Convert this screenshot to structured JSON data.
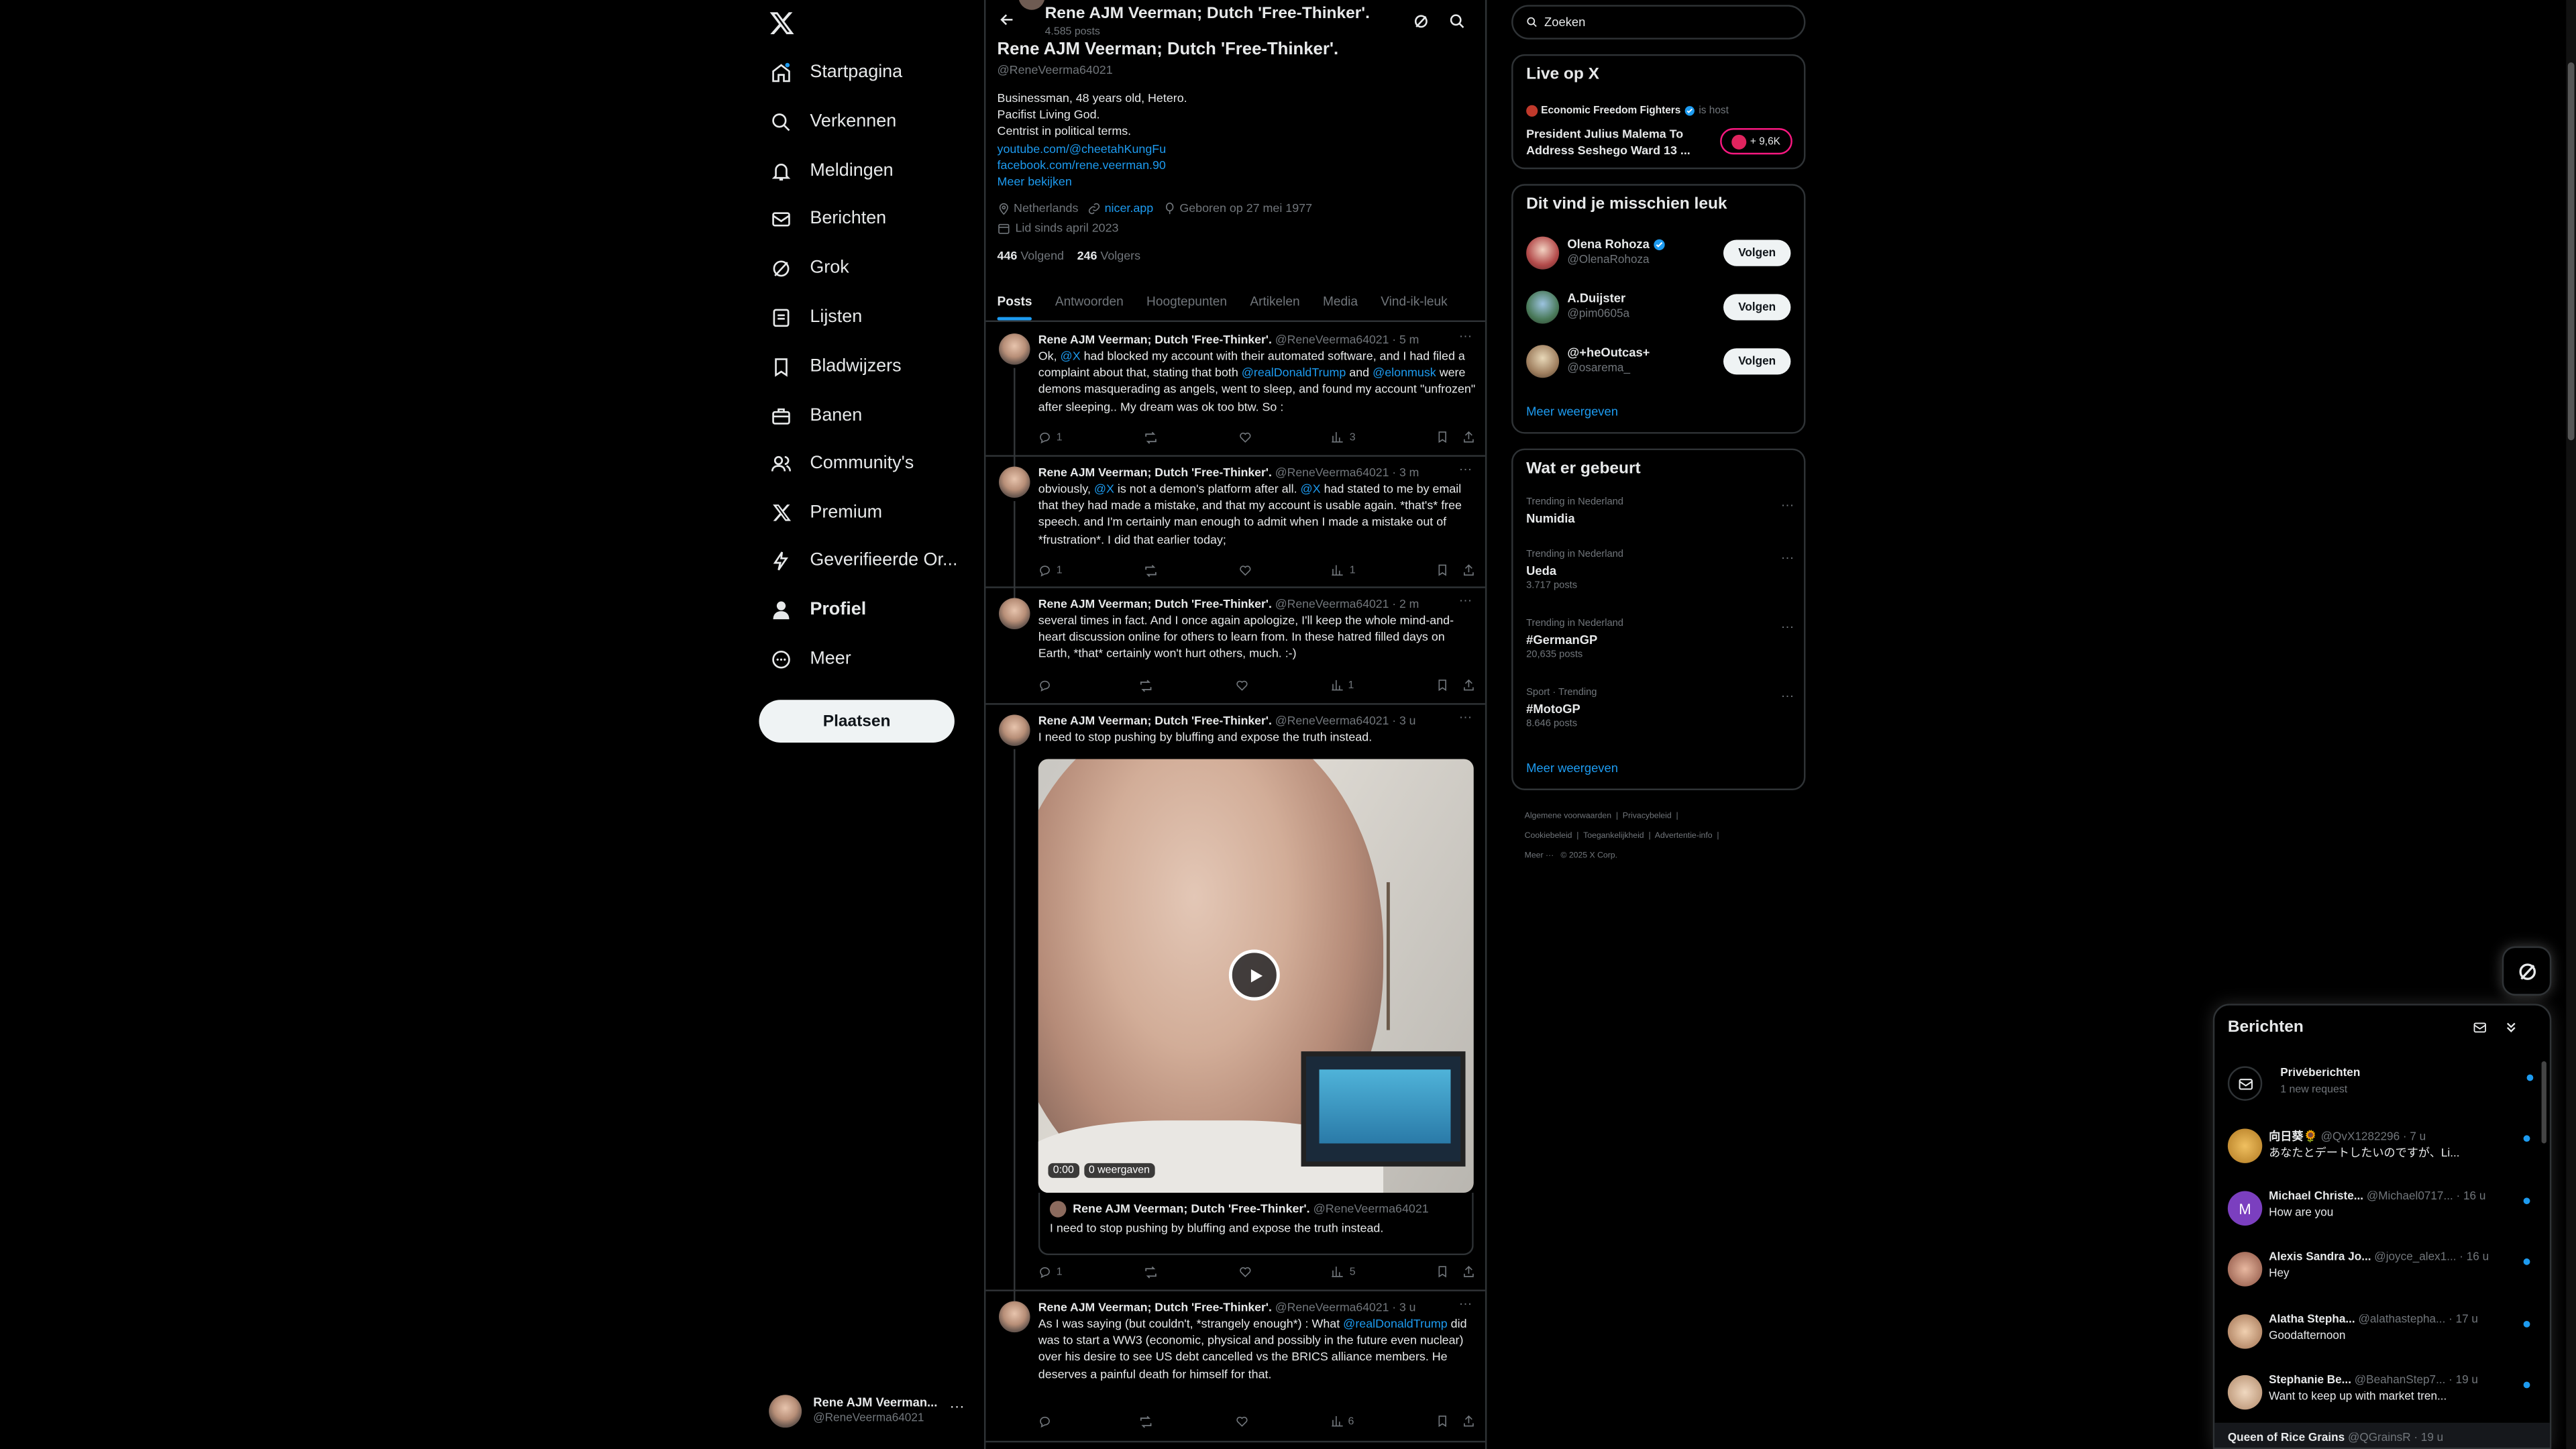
{
  "nav": {
    "items": [
      {
        "label": "Startpagina",
        "icon": "home-icon"
      },
      {
        "label": "Verkennen",
        "icon": "search-icon"
      },
      {
        "label": "Meldingen",
        "icon": "bell-icon"
      },
      {
        "label": "Berichten",
        "icon": "mail-icon"
      },
      {
        "label": "Grok",
        "icon": "grok-icon"
      },
      {
        "label": "Lijsten",
        "icon": "list-icon"
      },
      {
        "label": "Bladwijzers",
        "icon": "bookmark-icon"
      },
      {
        "label": "Banen",
        "icon": "briefcase-icon"
      },
      {
        "label": "Community's",
        "icon": "people-icon"
      },
      {
        "label": "Premium",
        "icon": "x-icon"
      },
      {
        "label": "Geverifieerde Or...",
        "icon": "lightning-icon"
      },
      {
        "label": "Profiel",
        "icon": "person-icon"
      },
      {
        "label": "Meer",
        "icon": "more-icon"
      }
    ],
    "post_button": "Plaatsen",
    "account": {
      "name": "Rene AJM Veerman...",
      "handle": "@ReneVeerma64021"
    }
  },
  "header": {
    "name": "Rene AJM Veerman; Dutch 'Free-Thinker'.",
    "posts": "4.585 posts"
  },
  "profile": {
    "name": "Rene AJM Veerman; Dutch 'Free-Thinker'.",
    "handle": "@ReneVeerma64021",
    "bio": [
      "Businessman, 48 years old, Hetero.",
      "Pacifist Living God.",
      "Centrist in political terms."
    ],
    "links": [
      "youtube.com/@cheetahKungFu",
      "facebook.com/rene.veerman.90"
    ],
    "more": "Meer bekijken",
    "location": "Netherlands",
    "website": "nicer.app",
    "birth": "Geboren op 27 mei 1977",
    "joined": "Lid sinds april 2023",
    "following_count": "446",
    "following_label": "Volgend",
    "followers_count": "246",
    "followers_label": "Volgers"
  },
  "tabs": [
    "Posts",
    "Antwoorden",
    "Hoogtepunten",
    "Artikelen",
    "Media",
    "Vind-ik-leuk"
  ],
  "tweets": [
    {
      "name": "Rene AJM Veerman; Dutch 'Free-Thinker'.",
      "meta": "@ReneVeerma64021 · 5 m",
      "replies": "1",
      "views": "3"
    },
    {
      "name": "Rene AJM Veerman; Dutch 'Free-Thinker'.",
      "meta": "@ReneVeerma64021 · 3 m",
      "replies": "1",
      "views": "1"
    },
    {
      "name": "Rene AJM Veerman; Dutch 'Free-Thinker'.",
      "meta": "@ReneVeerma64021 · 2 m",
      "text": "several times in fact. And I once again apologize, I'll keep the whole mind-and-heart discussion online for others to learn from. In these hatred filled days on Earth, *that* certainly won't hurt others, much. :-)",
      "replies": "",
      "views": "1"
    },
    {
      "name": "Rene AJM Veerman; Dutch 'Free-Thinker'.",
      "meta": "@ReneVeerma64021 · 3 u",
      "text": "I need to stop pushing by bluffing and expose the truth instead.",
      "video_time": "0:00",
      "video_views": "0 weergaven",
      "quote_name": "Rene AJM Veerman; Dutch 'Free-Thinker'.",
      "quote_handle": "@ReneVeerma64021",
      "quote_text": "I need to stop pushing by bluffing and expose the truth instead.",
      "replies": "1",
      "views": "5"
    },
    {
      "name": "Rene AJM Veerman; Dutch 'Free-Thinker'.",
      "meta": "@ReneVeerma64021 · 3 u",
      "replies": "",
      "views": "6"
    }
  ],
  "t1": {
    "a": "Ok, ",
    "m1": "@X",
    "b": " had blocked my account with their automated software, and I had filed a complaint about that, stating that both ",
    "m2": "@realDonaldTrump",
    "c": " and ",
    "m3": "@elonmusk",
    "d": " were demons masquerading as angels, went to sleep, and found my account \"unfrozen\" after sleeping.. My dream was ok too btw. So :"
  },
  "t2": {
    "a": "obviously, ",
    "m1": "@X",
    "b": " is not a demon's platform after all. ",
    "m2": "@X",
    "c": " had stated to me by email that they had made a mistake, and that my account is usable again. *that's* free speech. and I'm certainly man enough to admit when I made a mistake out of *frustration*. I did that earlier today;"
  },
  "t5": {
    "a": "As I was saying (but couldn't, *strangely enough*) : What ",
    "m1": "@realDonaldTrump",
    "b": " did was to start a WW3 (economic, physical and possibly in the future even nuclear) over his desire to see US debt cancelled vs the BRICS alliance members. He deserves a painful death for himself for that."
  },
  "search": {
    "placeholder": "Zoeken"
  },
  "live": {
    "title": "Live op X",
    "host": "Economic Freedom Fighters",
    "host_suffix": "is host",
    "text": "President Julius Malema To Address Seshego Ward 13 ...",
    "count": "+ 9,6K"
  },
  "suggest": {
    "title": "Dit vind je misschien leuk",
    "users": [
      {
        "name": "Olena Rohoza",
        "handle": "@OlenaRohoza",
        "verified": true
      },
      {
        "name": "A.Duijster",
        "handle": "@pim0605a",
        "verified": false
      },
      {
        "name": "@+heOutcas+",
        "handle": "@osarema_",
        "verified": false
      }
    ],
    "follow_label": "Volgen",
    "more": "Meer weergeven"
  },
  "trends": {
    "title": "Wat er gebeurt",
    "items": [
      {
        "cat": "Trending in Nederland",
        "name": "Numidia",
        "count": ""
      },
      {
        "cat": "Trending in Nederland",
        "name": "Ueda",
        "count": "3.717 posts"
      },
      {
        "cat": "Trending in Nederland",
        "name": "#GermanGP",
        "count": "20,635 posts"
      },
      {
        "cat": "Sport · Trending",
        "name": "#MotoGP",
        "count": "8.646 posts"
      }
    ],
    "more": "Meer weergeven"
  },
  "footer": {
    "l1": [
      "Algemene voorwaarden",
      "Privacybeleid"
    ],
    "l2": [
      "Cookiebeleid",
      "Toegankelijkheid",
      "Advertentie-info"
    ],
    "l3": [
      "Meer ···",
      "© 2025 X Corp."
    ]
  },
  "dm": {
    "title": "Berichten",
    "requests_title": "Privéberichten",
    "requests_sub": "1 new request",
    "threads": [
      {
        "name": "向日葵🌻",
        "handle": "@QvX1282296 · 7 u",
        "msg": "あなたとデートしたいのですが、Li..."
      },
      {
        "name": "Michael Christe...",
        "handle": "@Michael0717... · 16 u",
        "msg": "How are you",
        "initial": "M"
      },
      {
        "name": "Alexis Sandra Jo...",
        "handle": "@joyce_alex1... · 16 u",
        "msg": "Hey"
      },
      {
        "name": "Alatha Stepha...",
        "handle": "@alathastepha... · 17 u",
        "msg": "Goodafternoon"
      },
      {
        "name": "Stephanie Be...",
        "handle": "@BeahanStep7... · 19 u",
        "msg": "Want to keep up with market tren..."
      },
      {
        "name": "Queen of Rice Grains",
        "handle": "@QGrainsR · 19 u",
        "msg": ""
      }
    ]
  },
  "colors": {
    "accent": "#1d9bf0",
    "bg": "#000000",
    "border": "#2f3336",
    "muted": "#71767b"
  }
}
